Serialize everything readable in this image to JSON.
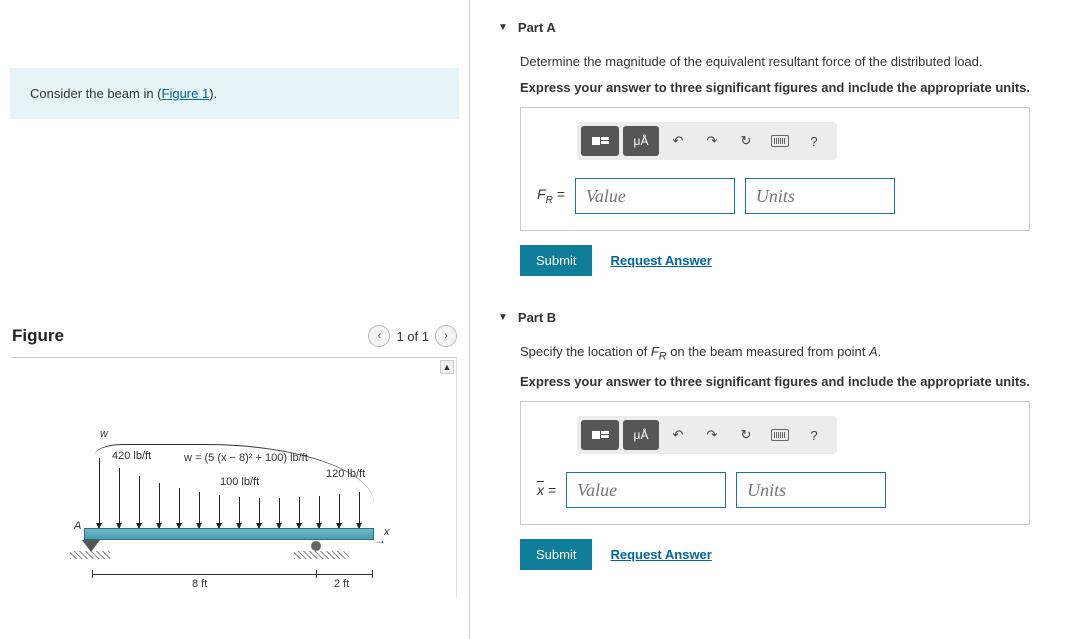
{
  "prompt": {
    "prefix": "Consider the beam in (",
    "link": "Figure 1",
    "suffix": ")."
  },
  "figure": {
    "title": "Figure",
    "nav_text": "1 of 1",
    "labels": {
      "w": "w",
      "left_load": "420 lb/ft",
      "equation": "w = (5 (x − 8)² + 100) lb/ft",
      "mid_load": "100 lb/ft",
      "right_load": "120 lb/ft",
      "pointA": "A",
      "x_axis": "x",
      "dim_left": "8 ft",
      "dim_right": "2 ft"
    }
  },
  "partA": {
    "title": "Part A",
    "line1": "Determine the magnitude of the equivalent resultant force of the distributed load.",
    "line2": "Express your answer to three significant figures and include the appropriate units.",
    "var_html": "F",
    "var_sub": "R",
    "equals": " = ",
    "value_ph": "Value",
    "units_ph": "Units",
    "submit": "Submit",
    "request": "Request Answer",
    "mua": "μÅ",
    "help": "?"
  },
  "partB": {
    "title": "Part B",
    "line1_a": "Specify the location of ",
    "line1_b": " on the beam measured from point ",
    "line1_c": ".",
    "FR_html": "F",
    "FR_sub": "R",
    "A_label": "A",
    "line2": "Express your answer to three significant figures and include the appropriate units.",
    "var": "x",
    "equals": " = ",
    "value_ph": "Value",
    "units_ph": "Units",
    "submit": "Submit",
    "request": "Request Answer",
    "mua": "μÅ",
    "help": "?"
  }
}
